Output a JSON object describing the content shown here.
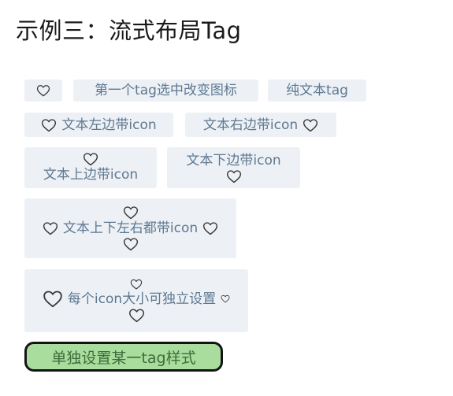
{
  "page": {
    "title": "示例三：流式布局Tag"
  },
  "tags": {
    "icon_only": {
      "icon": "heart-outline-icon"
    },
    "first_tag_toggle": {
      "label": "第一个tag选中改变图标"
    },
    "text_only": {
      "label": "纯文本tag"
    },
    "icon_left": {
      "label": "文本左边带icon",
      "icon": "heart-outline-icon"
    },
    "icon_right": {
      "label": "文本右边带icon",
      "icon": "heart-outline-icon"
    },
    "icon_top": {
      "label": "文本上边带icon",
      "icon": "heart-outline-icon"
    },
    "icon_bottom": {
      "label": "文本下边带icon",
      "icon": "heart-outline-icon"
    },
    "icon_all_sides": {
      "label": "文本上下左右都带icon",
      "icon": "heart-outline-icon"
    },
    "independent_icon_size": {
      "label": "每个icon大小可独立设置",
      "icon": "heart-outline-icon"
    },
    "custom_style": {
      "label": "单独设置某一tag样式"
    }
  },
  "colors": {
    "tag_background": "#edf1f6",
    "tag_text": "#5e7890",
    "icon_stroke": "#3a3a3a",
    "custom_tag_background": "#a8dd9e",
    "custom_tag_border": "#141414",
    "custom_tag_text": "#3f6c3a"
  }
}
